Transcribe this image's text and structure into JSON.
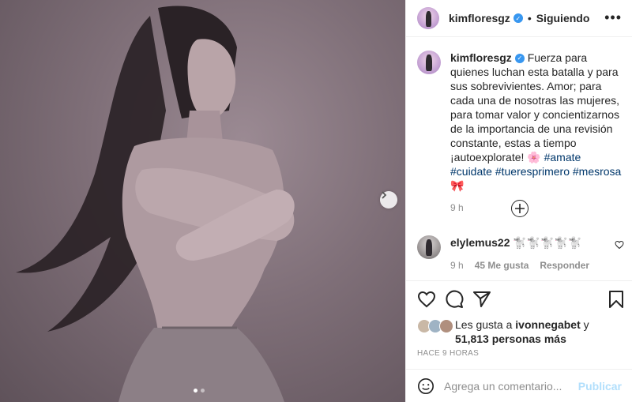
{
  "post": {
    "username": "kimfloresgz",
    "follow_label": "Siguiendo",
    "separator": "•",
    "more_icon": "more-horizontal-icon",
    "verified_icon": "verified-badge-icon"
  },
  "caption": {
    "username": "kimfloresgz",
    "text": "Fuerza para quienes luchan esta batalla y para sus sobrevivientes. Amor; para cada una de nosotras las mujeres, para tomar valor y concientizarnos de la importancia de una revisión constante, estas a tiempo ¡autoexplorate! 🌸",
    "hashtags": [
      "#amate",
      "#cuidate",
      "#tueresprimero",
      "#mesrosa🎀"
    ],
    "time": "9 h"
  },
  "load_more_icon": "plus-circle-icon",
  "comment": {
    "username": "elylemus22",
    "text": "🐩🐩🐩🐩🐩",
    "time": "9 h",
    "likes": "45 Me gusta",
    "reply_label": "Responder"
  },
  "likes": {
    "prefix": "Les gusta a",
    "first_user": "ivonnegabet",
    "conjunction": "y",
    "count_text": "51,813 personas más"
  },
  "posted_time": "HACE 9 HORAS",
  "add_comment": {
    "placeholder": "Agrega un comentario...",
    "publish_label": "Publicar"
  },
  "carousel": {
    "current": 1,
    "total": 2
  },
  "colors": {
    "link": "#00376b",
    "secondary": "#8e8e8e",
    "publish_disabled": "#b2dffc",
    "verified": "#3897f0"
  }
}
